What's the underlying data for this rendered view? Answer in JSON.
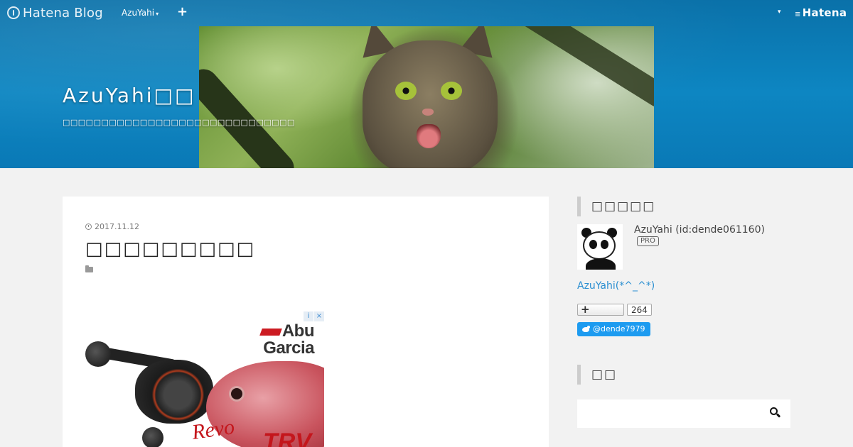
{
  "globalbar": {
    "logo_text": "Hatena Blog",
    "user_menu_label": "AzuYahi",
    "add_label": "+",
    "menu_caret": "▾",
    "brand_label": "Hatena"
  },
  "header": {
    "blog_title": "AzuYahi□□",
    "blog_description": "□□□□□□□□□□□□□□□□□□□□□□□□□□□□□□"
  },
  "article": {
    "date": "2017.11.12",
    "title": "□□□□□□□□□",
    "ad": {
      "info_icon": "i",
      "close_icon": "×",
      "brand_line1": "Abu",
      "brand_line2": "Garcia",
      "product_text": "Revo",
      "product_text2": "TRV"
    }
  },
  "sidebar": {
    "profile": {
      "heading": "□□□□□",
      "name": "AzuYahi (id:dende061160)",
      "badge": "PRO",
      "link_text": "AzuYahi(*^_^*)",
      "follow_count": "264",
      "twitter_handle": "@dende7979"
    },
    "search": {
      "heading": "□□",
      "placeholder": ""
    }
  },
  "colors": {
    "header_blue": "#0d86c2",
    "link_blue": "#2b8fd1",
    "twitter_blue": "#1d9bf0",
    "page_bg": "#f2f2f2"
  },
  "icons": [
    "hatena-logo-icon",
    "clock-icon",
    "folder-icon",
    "search-icon",
    "twitter-bird-icon",
    "ad-info-icon",
    "ad-close-icon",
    "plus-icon"
  ]
}
